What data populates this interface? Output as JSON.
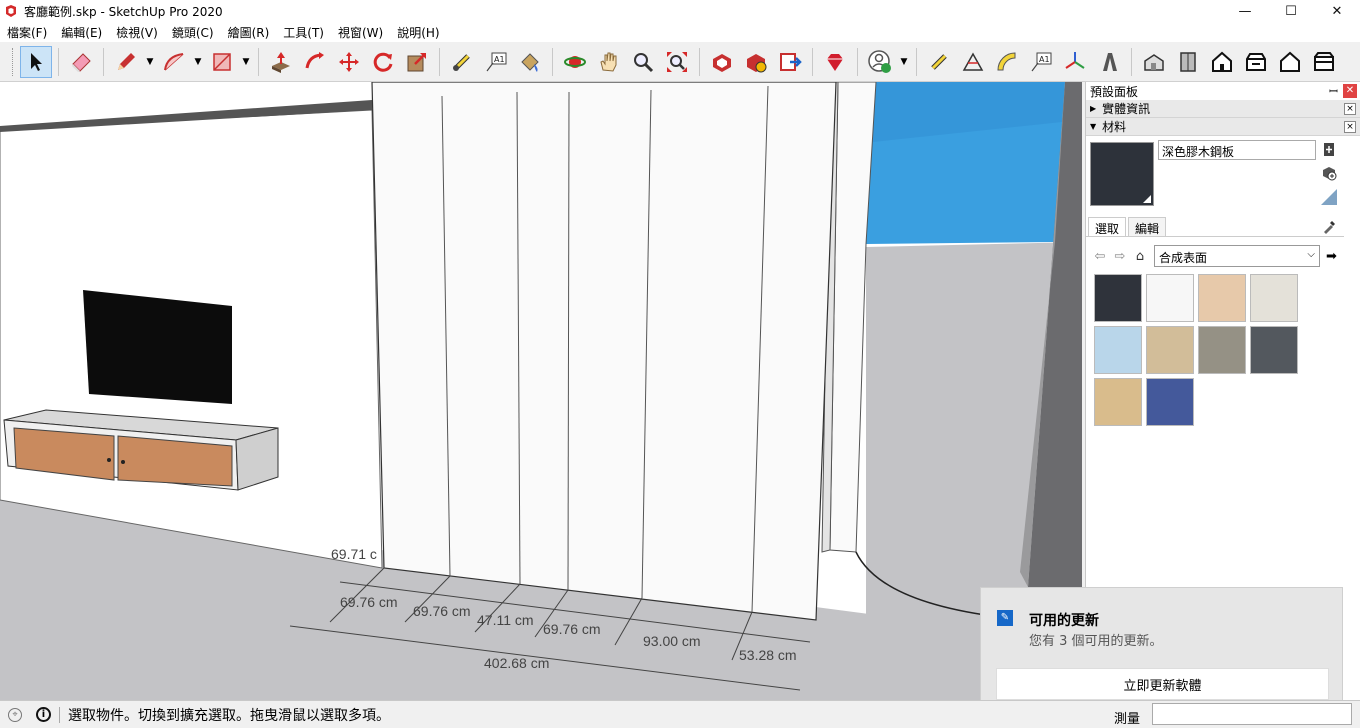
{
  "window": {
    "title": "客廳範例.skp - SketchUp Pro 2020",
    "min_glyph": "—",
    "max_glyph": "☐",
    "close_glyph": "✕"
  },
  "menu": [
    "檔案(F)",
    "編輯(E)",
    "檢視(V)",
    "鏡頭(C)",
    "繪圖(R)",
    "工具(T)",
    "視窗(W)",
    "說明(H)"
  ],
  "toolbar": {
    "icons": [
      "select-icon",
      "eraser-icon",
      "pencil-icon",
      "arc-icon",
      "rectangle-icon",
      "push-pull-icon",
      "follow-me-icon",
      "move-icon",
      "rotate-icon",
      "scale-icon",
      "tape-measure-icon",
      "text-icon",
      "paint-bucket-icon",
      "orbit-icon",
      "pan-icon",
      "zoom-icon",
      "zoom-extents-icon",
      "warehouse-icon",
      "extension-icon",
      "send-icon",
      "ruby-icon",
      "profile-icon",
      "dimension-icon",
      "protractor-icon",
      "label-icon",
      "axes-icon",
      "section-icon",
      "iso-view-icon",
      "front-view-icon",
      "top-view-icon",
      "right-view-icon",
      "back-view-icon",
      "left-view-icon"
    ]
  },
  "viewport": {
    "dimensions": [
      "69.71 c",
      "69.76 cm",
      "69.76 cm",
      "47.11 cm",
      "69.76 cm",
      "93.00 cm",
      "53.28 cm",
      "402.68 cm"
    ]
  },
  "tray": {
    "title": "預設面板",
    "pin_glyph": "ꟷ",
    "close_glyph": "✕",
    "entity_info_label": "實體資訊",
    "materials_label": "材料",
    "panel_close_glyph": "×",
    "material_name": "深色膠木鋼板",
    "tabs": {
      "select": "選取",
      "edit": "編輯"
    },
    "collection": "合成表面",
    "swatches": [
      "#2f333b",
      "#f7f7f7",
      "#e7c9aa",
      "#e4e1d9",
      "#b9d6ea",
      "#d2bd99",
      "#959185",
      "#53585e",
      "#d9bc8c",
      "#44599b"
    ],
    "colors": {
      "preview": "#2d323a",
      "header_bg": "#e9e9e9"
    }
  },
  "toast": {
    "title": "可用的更新",
    "message": "您有 3 個可用的更新。",
    "button": "立即更新軟體"
  },
  "status": {
    "text": "選取物件。切換到擴充選取。拖曳滑鼠以選取多項。",
    "measure_label": "測量"
  }
}
